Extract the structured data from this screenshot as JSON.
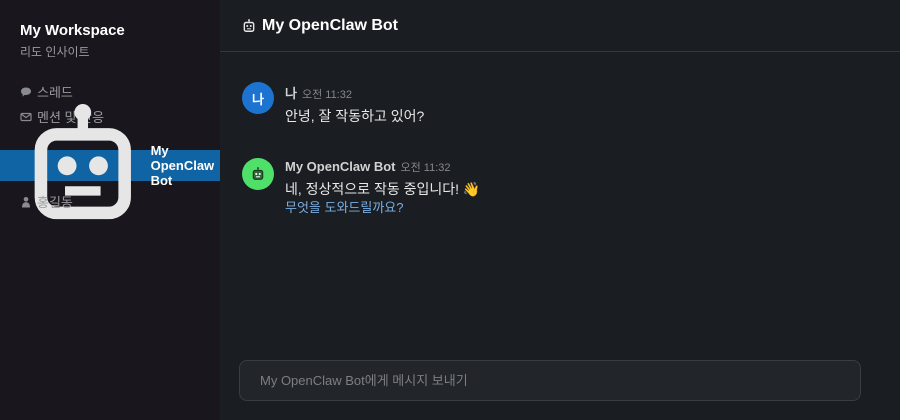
{
  "sidebar": {
    "workspace_title": "My Workspace",
    "workspace_subtitle": "리도 인사이트",
    "threads_label": "스레드",
    "mentions_label": "멘션 및 반응",
    "bot_channel_label": "My OpenClaw Bot",
    "user_label": "홍길동"
  },
  "header": {
    "title": "My OpenClaw Bot"
  },
  "messages": [
    {
      "avatar_text": "나",
      "sender": "나",
      "time": "오전 11:32",
      "text": "안녕, 잘 작동하고 있어?"
    },
    {
      "sender": "My OpenClaw Bot",
      "time": "오전 11:32",
      "text": "네, 정상적으로 작동 중입니다! 👋",
      "link_text": "무엇을 도와드릴까요?"
    }
  ],
  "composer": {
    "placeholder": "My OpenClaw Bot에게 메시지 보내기"
  },
  "colors": {
    "accent": "#1164a3",
    "my_avatar": "#1d74d0",
    "bot_avatar": "#4fe06a",
    "link": "#79aee3"
  }
}
